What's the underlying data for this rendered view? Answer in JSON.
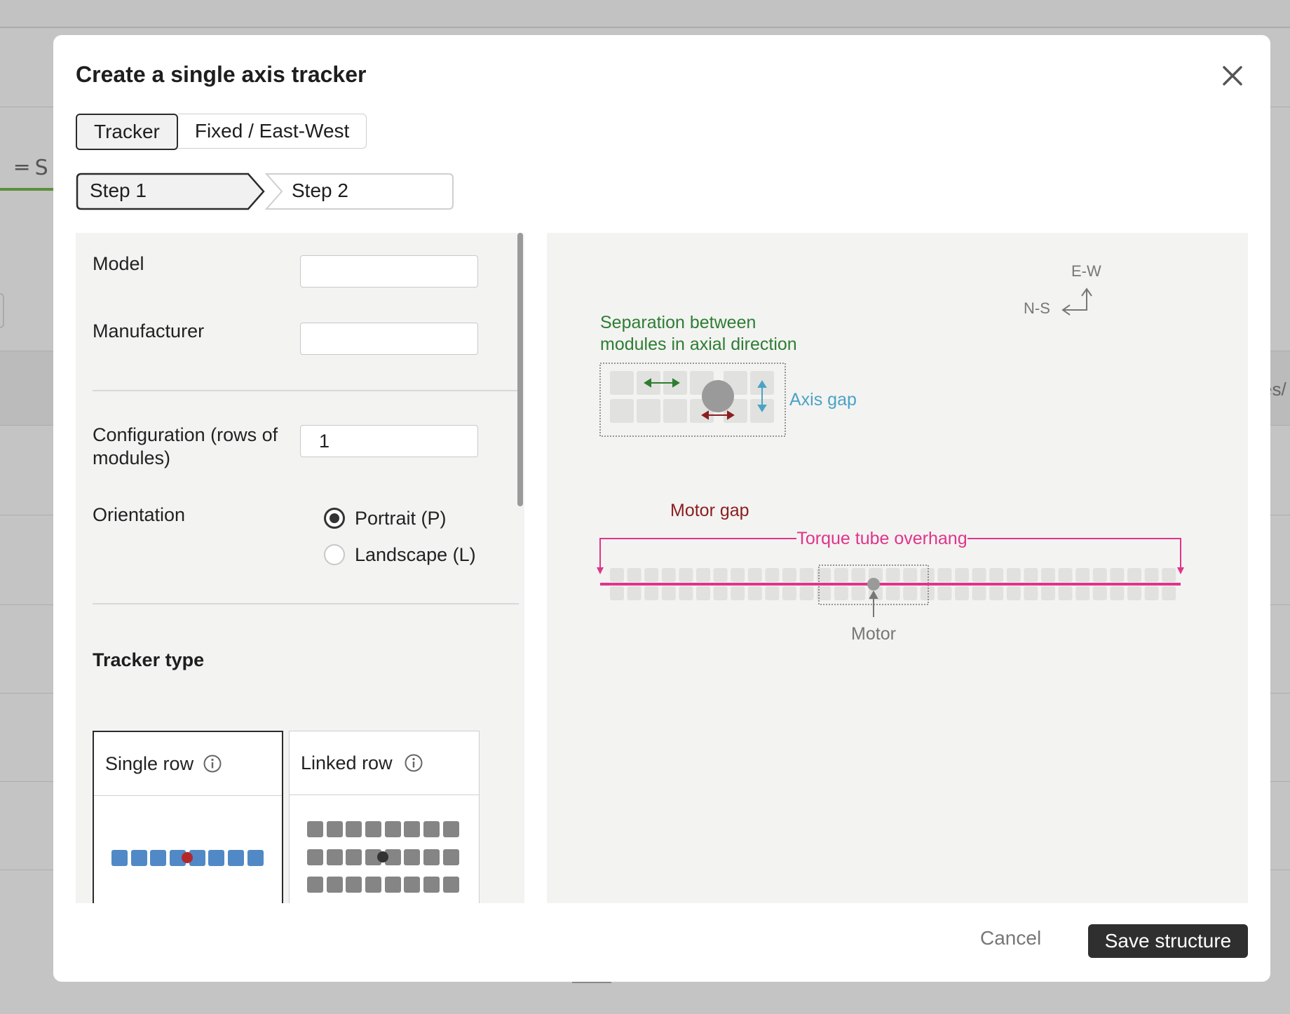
{
  "background": {
    "menu_partial": "═ S",
    "right_partial": "es/"
  },
  "modal": {
    "title": "Create a single axis tracker",
    "close_icon": "close-icon",
    "tabs": [
      {
        "label": "Tracker",
        "active": true
      },
      {
        "label": "Fixed / East-West",
        "active": false
      }
    ],
    "steps": [
      {
        "label": "Step 1",
        "active": true
      },
      {
        "label": "Step 2",
        "active": false
      }
    ],
    "form": {
      "model_label": "Model",
      "model_value": "",
      "manufacturer_label": "Manufacturer",
      "manufacturer_value": "",
      "configuration_label": "Configuration (rows of modules)",
      "configuration_value": "1",
      "orientation_label": "Orientation",
      "orientation_options": [
        {
          "label": "Portrait (P)",
          "checked": true
        },
        {
          "label": "Landscape (L)",
          "checked": false
        }
      ],
      "tracker_type_heading": "Tracker type",
      "tracker_types": [
        {
          "label": "Single row",
          "selected": true,
          "icon": "info-icon"
        },
        {
          "label": "Linked row",
          "selected": false,
          "icon": "info-icon"
        }
      ]
    },
    "diagram": {
      "compass_ew": "E-W",
      "compass_ns": "N-S",
      "separation_line1": "Separation between",
      "separation_line2": "modules in axial direction",
      "axis_gap": "Axis gap",
      "motor_gap": "Motor gap",
      "torque_overhang": "Torque tube overhang",
      "motor": "Motor",
      "colors": {
        "separation": "#2e7d32",
        "axis_gap": "#4aa3c4",
        "motor_gap": "#8b1e1e",
        "torque": "#e0358a",
        "module_blue": "#5189c6",
        "motor_red": "#b3282d"
      }
    },
    "footer": {
      "cancel_label": "Cancel",
      "save_label": "Save structure"
    }
  }
}
